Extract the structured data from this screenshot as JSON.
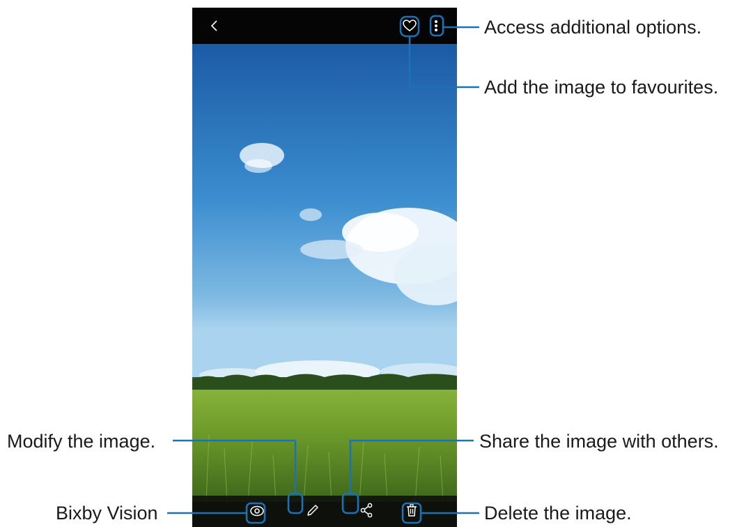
{
  "colors": {
    "accent_line": "#1a73b8",
    "sky_top": "#1a5ea8",
    "sky_bottom": "#8fc3e6",
    "grass_top": "#6e9c2c",
    "grass_bottom": "#3f6a1d",
    "bar_bg": "#050505"
  },
  "topbar": {
    "icons": [
      "back-arrow-icon",
      "heart-icon",
      "more-options-icon"
    ]
  },
  "bottombar": {
    "icons": [
      "bixby-vision-icon",
      "edit-pencil-icon",
      "share-icon",
      "delete-trash-icon"
    ]
  },
  "callouts": {
    "more_options": "Access additional options.",
    "favourite": "Add the image to favourites.",
    "modify": "Modify the image.",
    "share": "Share the image with others.",
    "bixby": "Bixby Vision",
    "delete": "Delete the image."
  }
}
